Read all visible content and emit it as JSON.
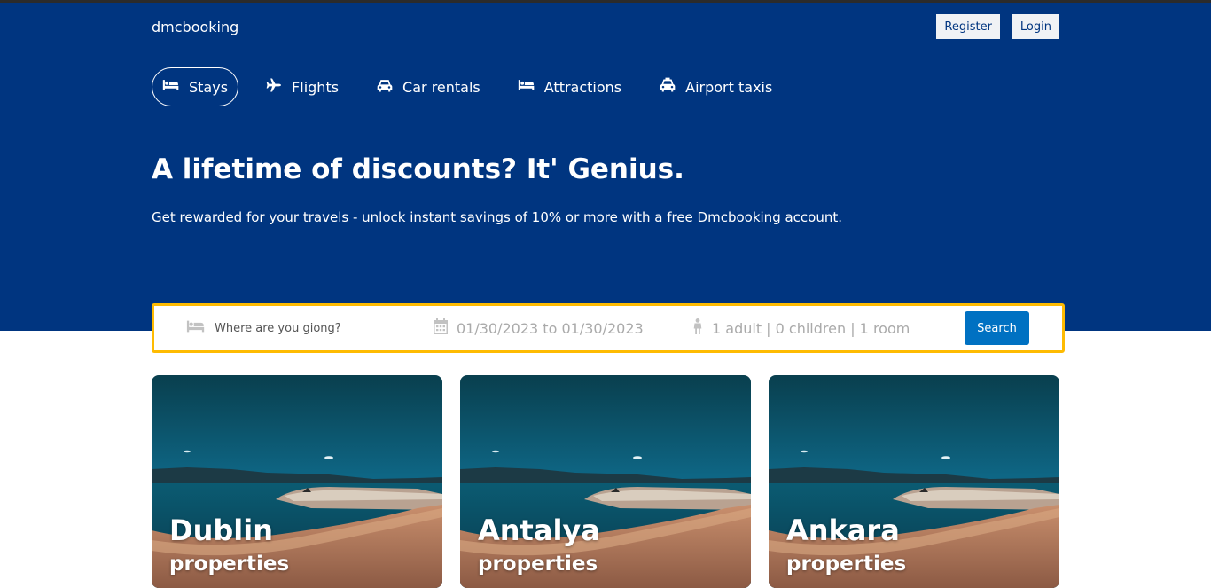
{
  "app": {
    "logo": "dmcbooking"
  },
  "navbar": {
    "register_label": "Register",
    "login_label": "Login"
  },
  "tabs": [
    {
      "label": "Stays",
      "icon": "bed-icon",
      "active": true
    },
    {
      "label": "Flights",
      "icon": "plane-icon",
      "active": false
    },
    {
      "label": "Car rentals",
      "icon": "car-icon",
      "active": false
    },
    {
      "label": "Attractions",
      "icon": "bed-icon",
      "active": false
    },
    {
      "label": "Airport taxis",
      "icon": "taxi-icon",
      "active": false
    }
  ],
  "hero": {
    "title": "A lifetime of discounts? It' Genius.",
    "subtitle": "Get rewarded for your travels - unlock instant savings of 10% or more with a free Dmcbooking account."
  },
  "search": {
    "destination_placeholder": "Where are you giong?",
    "date_range": "01/30/2023 to 01/30/2023",
    "guests": "1 adult | 0 children | 1 room",
    "button_label": "Search"
  },
  "cards": [
    {
      "city": "Dublin",
      "subtitle": "properties"
    },
    {
      "city": "Antalya",
      "subtitle": "properties"
    },
    {
      "city": "Ankara",
      "subtitle": "properties"
    }
  ],
  "colors": {
    "header_bg": "#003580",
    "search_border": "#febb02",
    "search_button": "#0071c2"
  }
}
